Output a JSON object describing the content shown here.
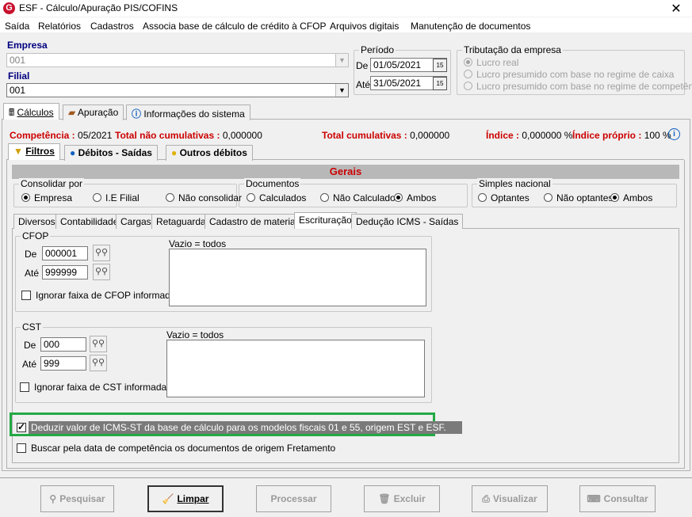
{
  "window": {
    "title": "ESF - Cálculo/Apuração PIS/COFINS",
    "icon_letter": "G",
    "close": "✕"
  },
  "menu": [
    "Saída",
    "Relatórios",
    "Cadastros",
    "Associa base de cálculo de crédito à CFOP",
    "Arquivos digitais",
    "Manutenção de documentos"
  ],
  "empresa": {
    "label": "Empresa",
    "value": "001"
  },
  "filial": {
    "label": "Filial",
    "value": "001"
  },
  "periodo": {
    "label": "Período",
    "de_label": "De",
    "de_value": "01/05/2021",
    "ate_label": "Até",
    "ate_value": "31/05/2021",
    "cal_icon": "15"
  },
  "tributacao": {
    "label": "Tributação da empresa",
    "options": [
      "Lucro real",
      "Lucro presumido com base no regime de caixa",
      "Lucro presumido com base no regime de competência"
    ]
  },
  "main_tabs": [
    "Cálculos",
    "Apuração",
    "Informações do sistema"
  ],
  "summary": {
    "competencia_label": "Competência :",
    "competencia_value": "05/2021",
    "nao_cum_label": "Total não cumulativas :",
    "nao_cum_value": "0,000000",
    "cum_label": "Total cumulativas :",
    "cum_value": "0,000000",
    "indice_label": "Índice :",
    "indice_value": "0,000000 %",
    "indice_proprio_label": "Índice próprio :",
    "indice_proprio_value": "100 %"
  },
  "calc_tabs": [
    "Filtros",
    "Débitos - Saídas",
    "Outros débitos"
  ],
  "gerais": {
    "title": "Gerais",
    "consolidar": {
      "label": "Consolidar por",
      "options": [
        "Empresa",
        "I.E Filial",
        "Não consolidar"
      ]
    },
    "documentos": {
      "label": "Documentos",
      "options": [
        "Calculados",
        "Não Calculados",
        "Ambos"
      ]
    },
    "simples": {
      "label": "Simples nacional",
      "options": [
        "Optantes",
        "Não optantes",
        "Ambos"
      ]
    }
  },
  "sub_tabs": [
    "Diversos",
    "Contabilidade",
    "Cargas",
    "Retaguarda",
    "Cadastro de materiais",
    "Escrituração",
    "Dedução ICMS - Saídas"
  ],
  "cfop": {
    "label": "CFOP",
    "de_label": "De",
    "de_value": "000001",
    "ate_label": "Até",
    "ate_value": "999999",
    "vazio": "Vazio = todos",
    "ignorar": "Ignorar faixa de CFOP informada"
  },
  "cst": {
    "label": "CST",
    "de_label": "De",
    "de_value": "000",
    "ate_label": "Até",
    "ate_value": "999",
    "vazio": "Vazio = todos",
    "ignorar": "Ignorar faixa de CST informada"
  },
  "deduzir": "Deduzir valor de ICMS-ST da base de cálculo para os modelos fiscais 01 e 55, origem EST e ESF.",
  "buscar": "Buscar pela data de competência os documentos de origem Fretamento",
  "buttons": [
    "Pesquisar",
    "Limpar",
    "Processar",
    "Excluir",
    "Visualizar",
    "Consultar"
  ],
  "colors": {
    "highlight_border": "#22aa44",
    "label_blue": "#000080",
    "summary_red": "#cc0000"
  }
}
